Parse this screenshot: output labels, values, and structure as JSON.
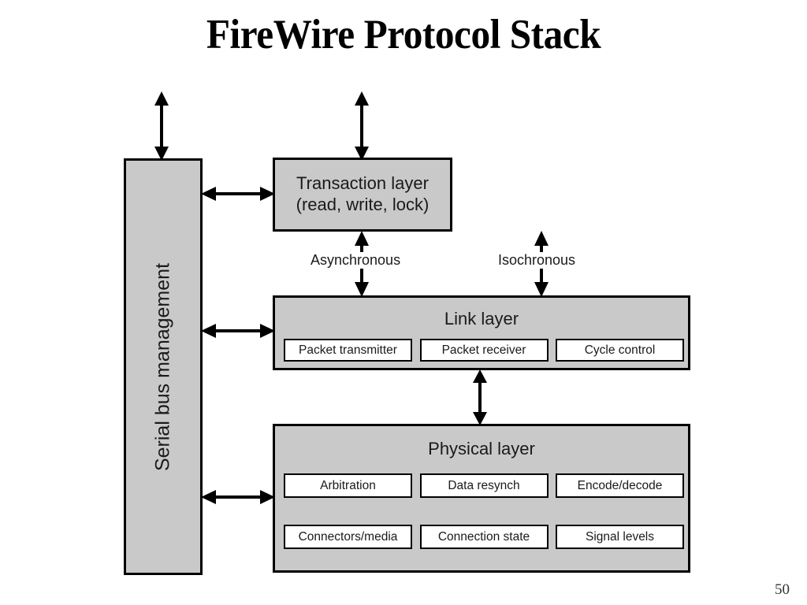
{
  "slide": {
    "title": "FireWire Protocol Stack",
    "page_number": "50"
  },
  "colors": {
    "box_fill": "#c9c9c9",
    "subbox_fill": "#ffffff",
    "stroke": "#000000",
    "text": "#1a1a1a",
    "background": "#ffffff"
  },
  "diagram": {
    "type": "block-diagram",
    "serial_bus_management": {
      "label": "Serial bus management",
      "orientation": "vertical"
    },
    "transaction_layer": {
      "line1": "Transaction layer",
      "line2": "(read, write, lock)"
    },
    "link_layer": {
      "title": "Link layer",
      "sub_blocks": [
        "Packet transmitter",
        "Packet receiver",
        "Cycle control"
      ]
    },
    "physical_layer": {
      "title": "Physical layer",
      "sub_blocks_row1": [
        "Arbitration",
        "Data resynch",
        "Encode/decode"
      ],
      "sub_blocks_row2": [
        "Connectors/media",
        "Connection state",
        "Signal levels"
      ]
    },
    "flow_labels": {
      "asynchronous": "Asynchronous",
      "isochronous": "Isochronous"
    },
    "connections": [
      {
        "from": "above",
        "to": "serial bus management",
        "style": "double-arrow",
        "orientation": "vertical"
      },
      {
        "from": "above",
        "to": "transaction layer",
        "style": "double-arrow",
        "orientation": "vertical"
      },
      {
        "from": "serial bus management",
        "to": "transaction layer",
        "style": "double-arrow",
        "orientation": "horizontal"
      },
      {
        "from": "serial bus management",
        "to": "link layer",
        "style": "double-arrow",
        "orientation": "horizontal"
      },
      {
        "from": "serial bus management",
        "to": "physical layer",
        "style": "double-arrow",
        "orientation": "horizontal"
      },
      {
        "from": "transaction layer",
        "to": "link layer",
        "style": "double-arrow",
        "orientation": "vertical",
        "label": "Asynchronous"
      },
      {
        "from": "above",
        "to": "link layer",
        "style": "double-arrow",
        "orientation": "vertical",
        "label": "Isochronous"
      },
      {
        "from": "link layer",
        "to": "physical layer",
        "style": "double-arrow",
        "orientation": "vertical"
      }
    ]
  }
}
